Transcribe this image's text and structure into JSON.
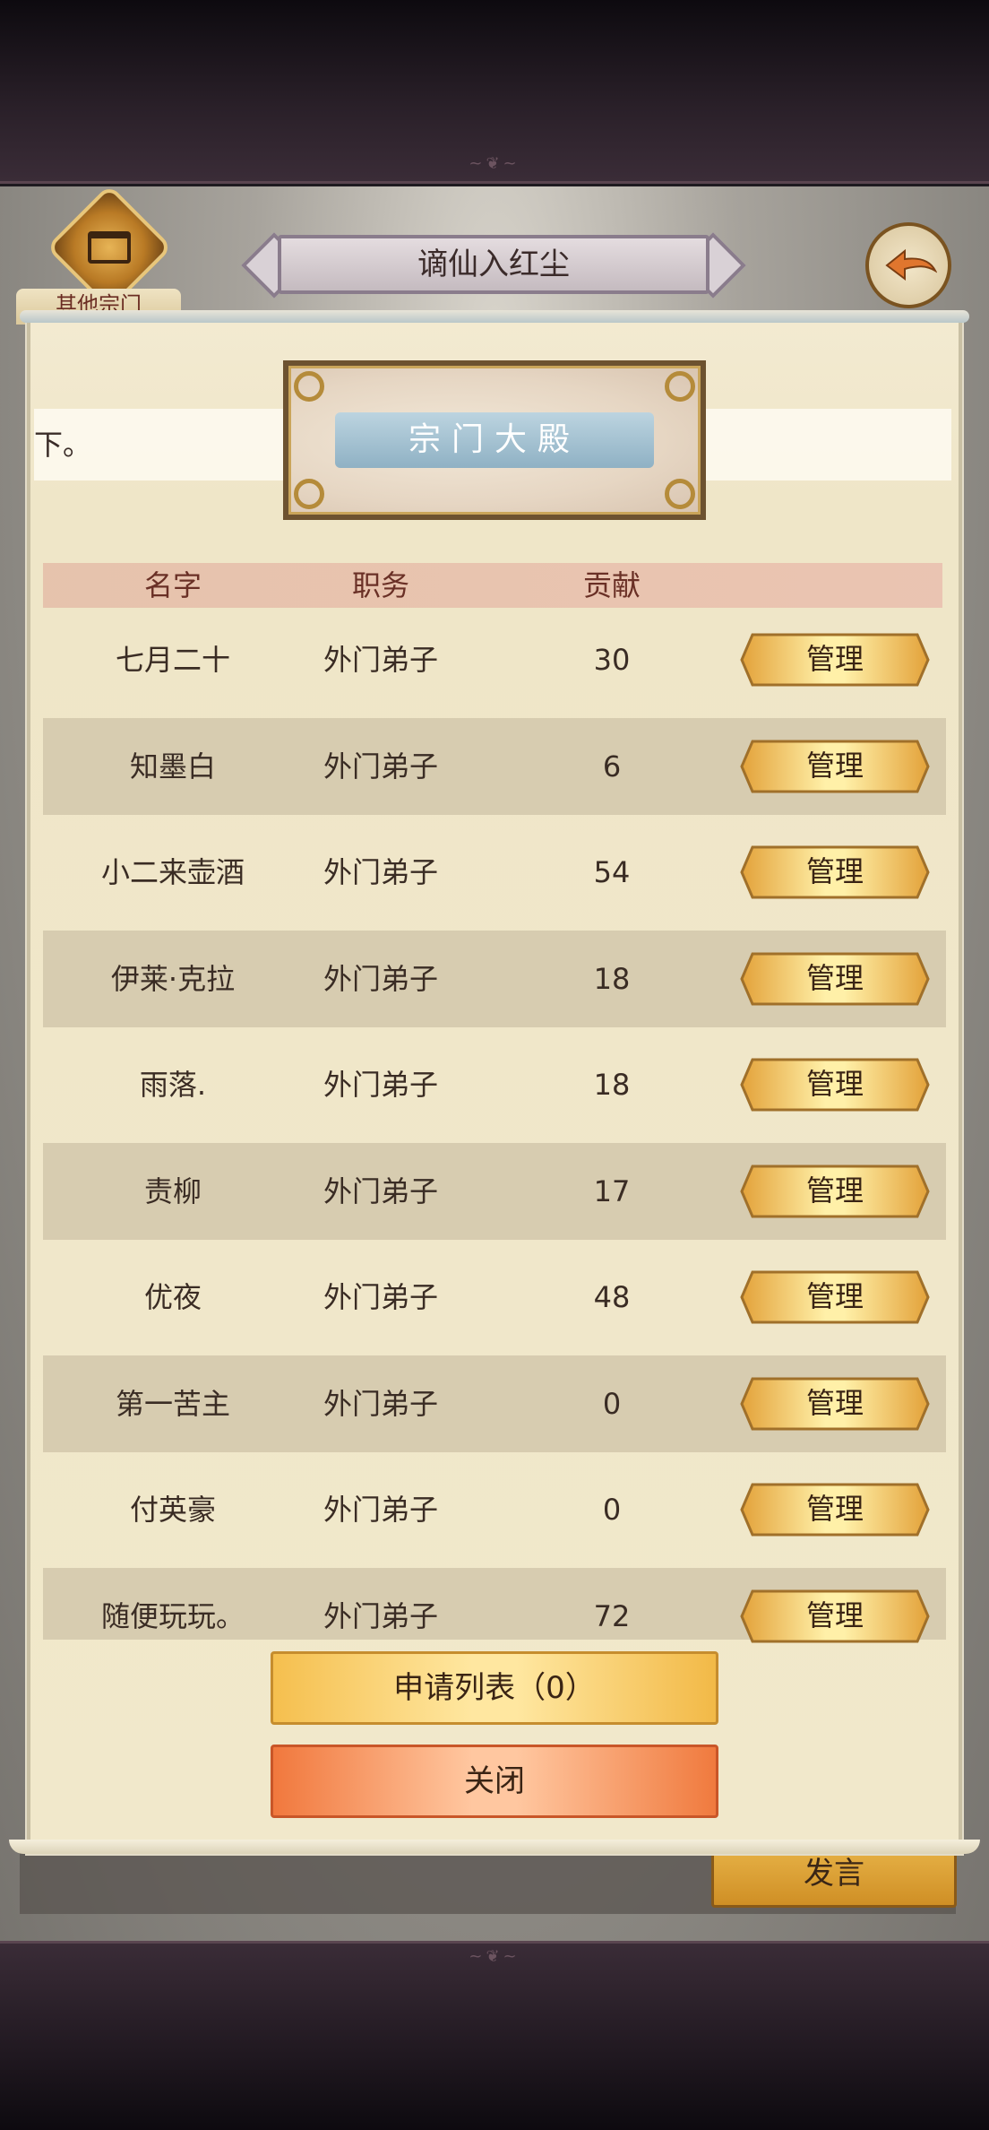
{
  "header": {
    "title": "谪仙入红尘",
    "other_sects_label": "其他宗门"
  },
  "banner": {
    "scrolling_text": "下。"
  },
  "hall": {
    "title": "宗门大殿"
  },
  "table": {
    "columns": [
      "名字",
      "职务",
      "贡献"
    ],
    "rows": [
      {
        "name": "七月二十",
        "role": "外门弟子",
        "contribution": "30",
        "action": "管理"
      },
      {
        "name": "知墨白",
        "role": "外门弟子",
        "contribution": "6",
        "action": "管理"
      },
      {
        "name": "小二来壶酒",
        "role": "外门弟子",
        "contribution": "54",
        "action": "管理"
      },
      {
        "name": "伊莱·克拉",
        "role": "外门弟子",
        "contribution": "18",
        "action": "管理"
      },
      {
        "name": "雨落.",
        "role": "外门弟子",
        "contribution": "18",
        "action": "管理"
      },
      {
        "name": "责柳",
        "role": "外门弟子",
        "contribution": "17",
        "action": "管理"
      },
      {
        "name": "优夜",
        "role": "外门弟子",
        "contribution": "48",
        "action": "管理"
      },
      {
        "name": "第一苦主",
        "role": "外门弟子",
        "contribution": "0",
        "action": "管理"
      },
      {
        "name": "付英豪",
        "role": "外门弟子",
        "contribution": "0",
        "action": "管理"
      },
      {
        "name": "随便玩玩。",
        "role": "外门弟子",
        "contribution": "72",
        "action": "管理"
      }
    ]
  },
  "footer": {
    "apply_list_label": "申请列表（0）",
    "close_label": "关闭",
    "speak_label": "发言"
  },
  "colors": {
    "parchment": "#f1e8cb",
    "alt_row": "#d7ccb0",
    "gold": "#e9b54a",
    "close_orange": "#f1783d"
  },
  "icons": {
    "back": "back-arrow-icon",
    "sect": "sect-emblem-icon"
  }
}
